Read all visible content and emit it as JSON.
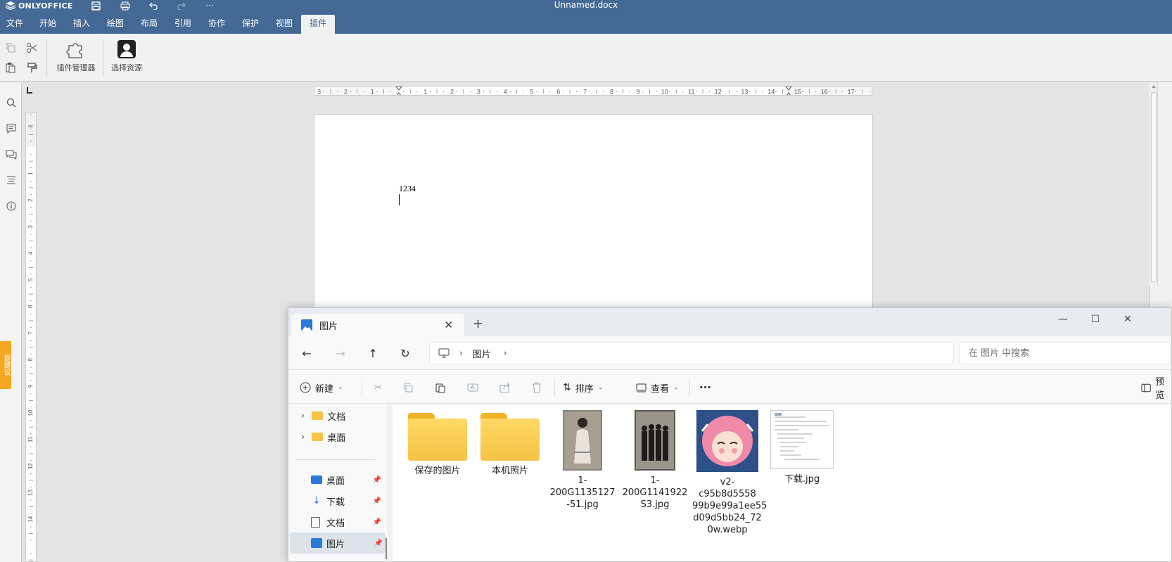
{
  "app": {
    "name": "ONLYOFFICE",
    "document_title": "Unnamed.docx"
  },
  "menu_tabs": [
    "文件",
    "开始",
    "插入",
    "绘图",
    "布局",
    "引用",
    "协作",
    "保护",
    "视图",
    "插件"
  ],
  "active_tab": "插件",
  "toolbar": {
    "plugin_manager_label": "插件管理器",
    "select_resource_label": "选择资源"
  },
  "feedback_label": "提建议",
  "ruler": {
    "h_left_numbers": [
      "3",
      "2",
      "1"
    ],
    "h_numbers": [
      "1",
      "2",
      "3",
      "4",
      "5",
      "6",
      "7",
      "8",
      "9",
      "10",
      "11",
      "12",
      "13",
      "14",
      "15",
      "16",
      "17"
    ],
    "v_top_numbers": [
      "2",
      "1"
    ],
    "v_numbers": [
      "1",
      "2",
      "3",
      "4",
      "5",
      "6",
      "7",
      "8",
      "9",
      "10",
      "11",
      "12",
      "13",
      "14"
    ]
  },
  "document": {
    "text": "1234"
  },
  "explorer": {
    "tab_title": "图片",
    "new_tab": "+",
    "breadcrumb": [
      "图片"
    ],
    "search_placeholder": "在 图片 中搜索",
    "cmd": {
      "new": "新建",
      "sort": "排序",
      "view": "查看",
      "more": "···",
      "preview": "预览"
    },
    "sidebar": [
      {
        "label": "文档",
        "type": "folder",
        "expand": true
      },
      {
        "label": "桌面",
        "type": "folder",
        "expand": true
      },
      {
        "label": "桌面",
        "type": "desktop",
        "pinned": true
      },
      {
        "label": "下载",
        "type": "download",
        "pinned": true
      },
      {
        "label": "文档",
        "type": "document",
        "pinned": true
      },
      {
        "label": "图片",
        "type": "pictures",
        "pinned": true,
        "selected": true
      }
    ],
    "files": [
      {
        "name": "保存的图片",
        "type": "folder"
      },
      {
        "name": "本机照片",
        "type": "folder"
      },
      {
        "name": "1-200G1135127\n-51.jpg",
        "type": "photo-bw"
      },
      {
        "name": "1-200G1141922\nS3.jpg",
        "type": "photo-bw-group"
      },
      {
        "name": "v2-c95b8d5558\n99b9e99a1ee55\nd09d5bb24_72\n0w.webp",
        "type": "anime"
      },
      {
        "name": "下载.jpg",
        "type": "document-scan"
      }
    ]
  },
  "colors": {
    "brand": "#446995",
    "accent": "#f5a623",
    "folder": "#f6c445"
  }
}
